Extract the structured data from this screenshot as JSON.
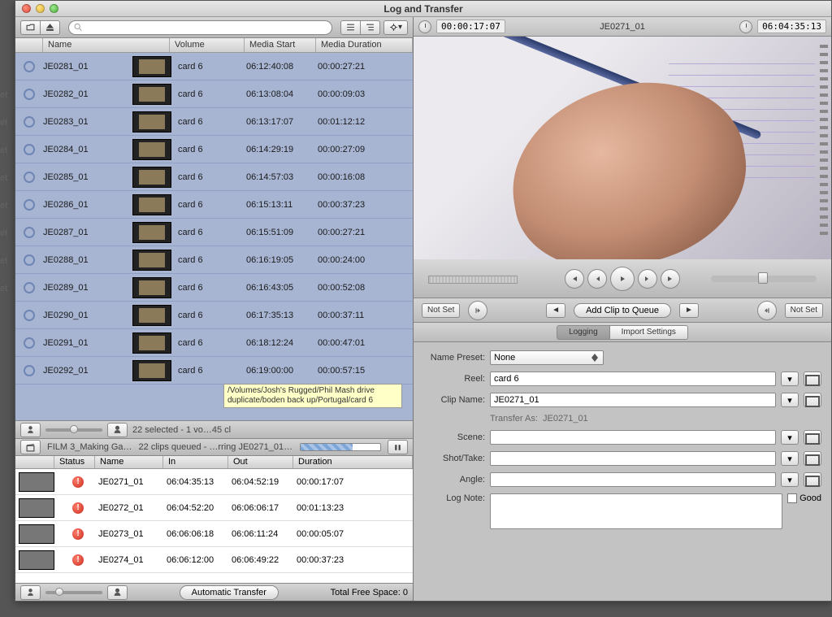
{
  "edge_text": "et",
  "window": {
    "title": "Log and Transfer"
  },
  "toolbar": {
    "search_placeholder": ""
  },
  "columns": {
    "name": "Name",
    "volume": "Volume",
    "media_start": "Media Start",
    "media_duration": "Media Duration"
  },
  "clips": [
    {
      "name": "JE0281_01",
      "volume": "card 6",
      "start": "06:12:40:08",
      "dur": "00:00:27:21"
    },
    {
      "name": "JE0282_01",
      "volume": "card 6",
      "start": "06:13:08:04",
      "dur": "00:00:09:03"
    },
    {
      "name": "JE0283_01",
      "volume": "card 6",
      "start": "06:13:17:07",
      "dur": "00:01:12:12"
    },
    {
      "name": "JE0284_01",
      "volume": "card 6",
      "start": "06:14:29:19",
      "dur": "00:00:27:09"
    },
    {
      "name": "JE0285_01",
      "volume": "card 6",
      "start": "06:14:57:03",
      "dur": "00:00:16:08"
    },
    {
      "name": "JE0286_01",
      "volume": "card 6",
      "start": "06:15:13:11",
      "dur": "00:00:37:23"
    },
    {
      "name": "JE0287_01",
      "volume": "card 6",
      "start": "06:15:51:09",
      "dur": "00:00:27:21"
    },
    {
      "name": "JE0288_01",
      "volume": "card 6",
      "start": "06:16:19:05",
      "dur": "00:00:24:00"
    },
    {
      "name": "JE0289_01",
      "volume": "card 6",
      "start": "06:16:43:05",
      "dur": "00:00:52:08"
    },
    {
      "name": "JE0290_01",
      "volume": "card 6",
      "start": "06:17:35:13",
      "dur": "00:00:37:11"
    },
    {
      "name": "JE0291_01",
      "volume": "card 6",
      "start": "06:18:12:24",
      "dur": "00:00:47:01"
    },
    {
      "name": "JE0292_01",
      "volume": "card 6",
      "start": "06:19:00:00",
      "dur": "00:00:57:15"
    }
  ],
  "status_text": "22 selected - 1 vo…45 cl",
  "tooltip": "/Volumes/Josh's Rugged/Phil Mash drive duplicate/boden back up/Portugal/card 6",
  "queue": {
    "project": "FILM 3_Making Ga…",
    "status": "22 clips queued - …rring JE0271_01…",
    "cols": {
      "status": "Status",
      "name": "Name",
      "in": "In",
      "out": "Out",
      "dur": "Duration"
    },
    "rows": [
      {
        "name": "JE0271_01",
        "in": "06:04:35:13",
        "out": "06:04:52:19",
        "dur": "00:00:17:07"
      },
      {
        "name": "JE0272_01",
        "in": "06:04:52:20",
        "out": "06:06:06:17",
        "dur": "00:01:13:23"
      },
      {
        "name": "JE0273_01",
        "in": "06:06:06:18",
        "out": "06:06:11:24",
        "dur": "00:00:05:07"
      },
      {
        "name": "JE0274_01",
        "in": "06:06:12:00",
        "out": "06:06:49:22",
        "dur": "00:00:37:23"
      }
    ]
  },
  "footer": {
    "auto": "Automatic Transfer",
    "free": "Total Free Space: 0"
  },
  "viewer": {
    "tc_in": "00:00:17:07",
    "clip_title": "JE0271_01",
    "tc_out": "06:04:35:13",
    "not_set": "Not Set",
    "add_clip": "Add Clip to Queue"
  },
  "tabs": {
    "logging": "Logging",
    "import": "Import Settings"
  },
  "form": {
    "name_preset_label": "Name Preset:",
    "name_preset": "None",
    "reel_label": "Reel:",
    "reel": "card 6",
    "clip_name_label": "Clip Name:",
    "clip_name": "JE0271_01",
    "transfer_as_label": "Transfer As:",
    "transfer_as": "JE0271_01",
    "scene_label": "Scene:",
    "shot_label": "Shot/Take:",
    "angle_label": "Angle:",
    "lognote_label": "Log Note:",
    "good": "Good"
  }
}
